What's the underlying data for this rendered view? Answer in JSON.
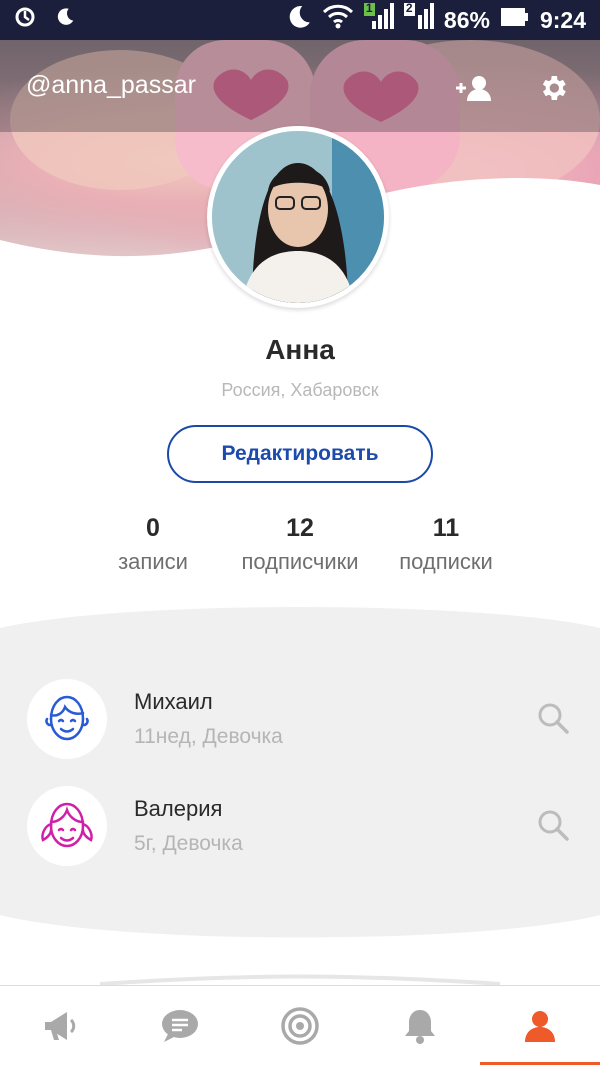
{
  "status_bar": {
    "battery": "86%",
    "time": "9:24",
    "sim1": "1",
    "sim2": "2"
  },
  "header": {
    "username": "@anna_passar",
    "add_user_icon": "add-user-icon",
    "settings_icon": "gear-icon"
  },
  "profile": {
    "name": "Анна",
    "location": "Россия, Хабаровск",
    "edit_label": "Редактировать"
  },
  "stats": [
    {
      "value": "0",
      "label": "записи"
    },
    {
      "value": "12",
      "label": "подписчики"
    },
    {
      "value": "11",
      "label": "подписки"
    }
  ],
  "children": [
    {
      "name": "Михаил",
      "info": "11нед, Девочка",
      "icon": "boy-face-icon",
      "color": "#2a5bd7"
    },
    {
      "name": "Валерия",
      "info": "5г, Девочка",
      "icon": "girl-face-icon",
      "color": "#d020a8"
    }
  ],
  "bottom_nav": {
    "items": [
      "megaphone-icon",
      "chat-icon",
      "target-icon",
      "bell-icon",
      "profile-icon"
    ],
    "active_index": 4,
    "active_color": "#ee5a2a",
    "inactive_color": "#a9a9a9"
  }
}
